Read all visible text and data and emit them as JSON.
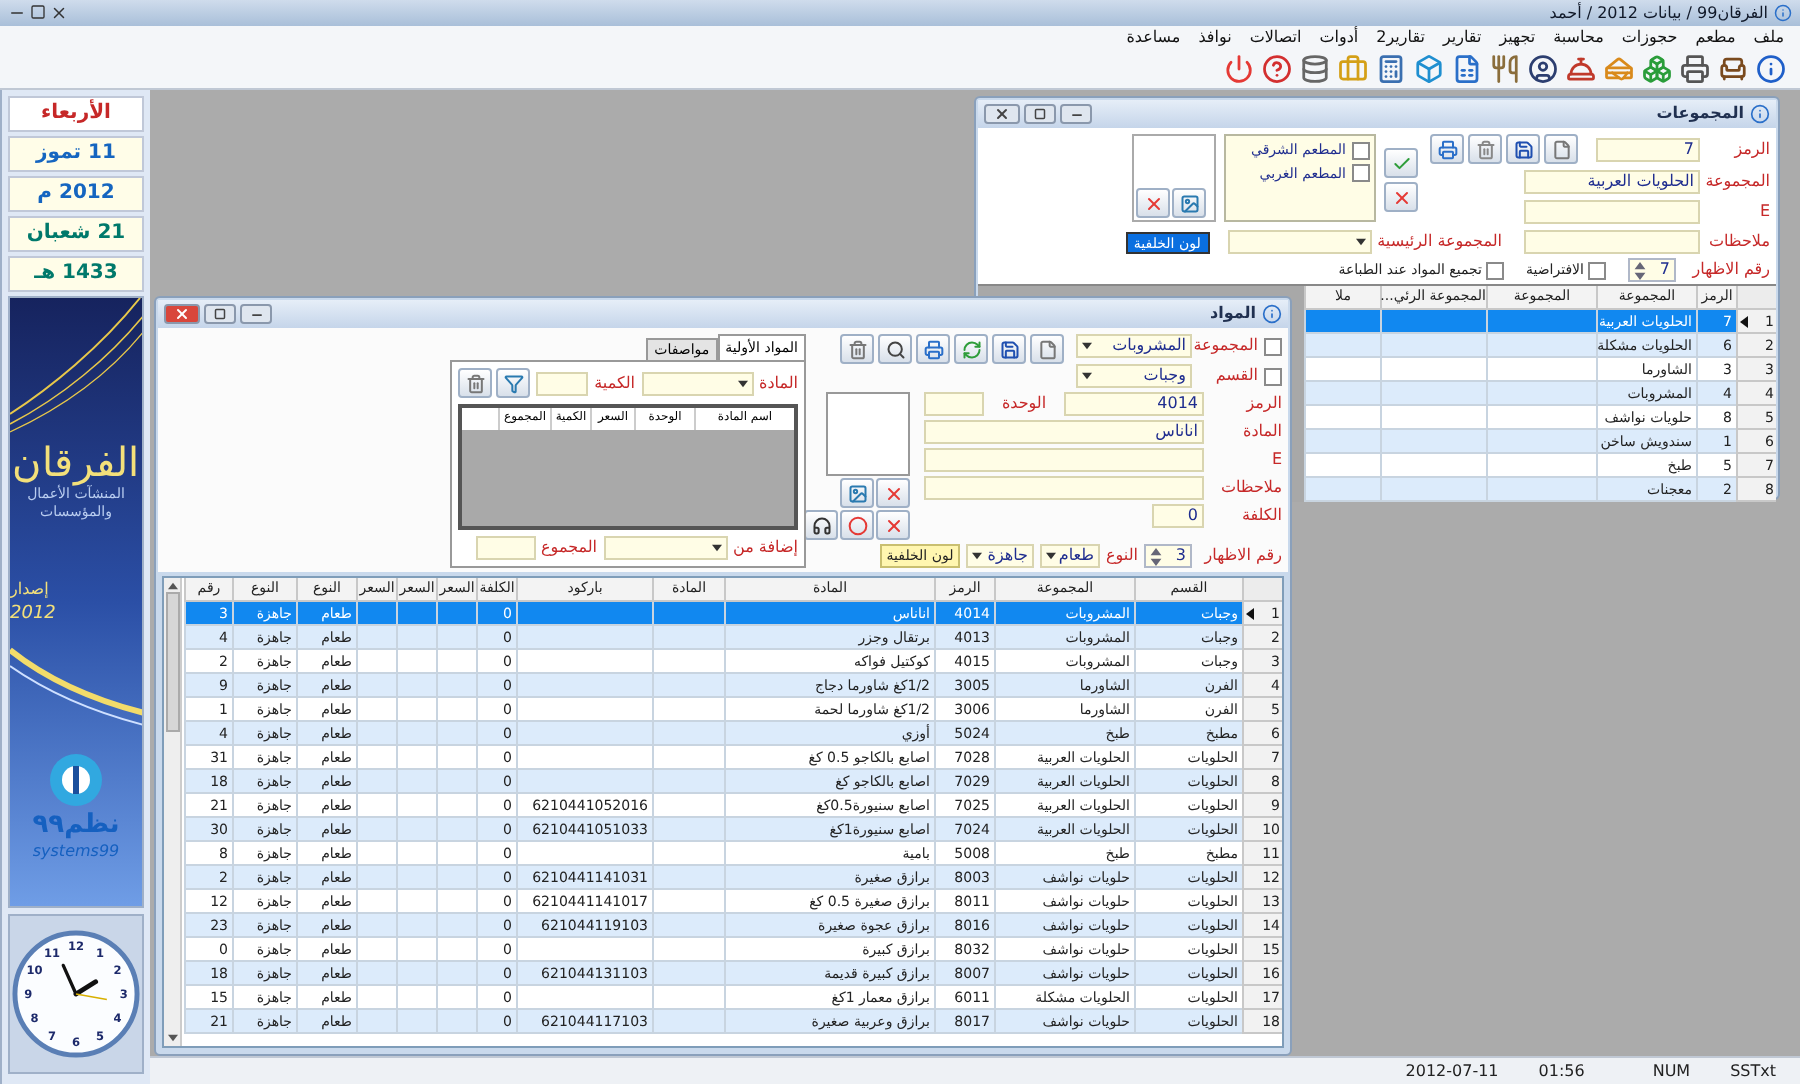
{
  "window": {
    "title": "الفرقان99 / بيانات 2012 / أحمد"
  },
  "menu": [
    "ملف",
    "مطعم",
    "حجوزات",
    "محاسبة",
    "تجهيز",
    "تقارير",
    "تقارير2",
    "أدوات",
    "اتصالات",
    "نوافذ",
    "مساعدة"
  ],
  "date_panel": {
    "weekday": "الأربعاء",
    "gregorian_date": "11 تموز",
    "gregorian_year": "2012 م",
    "hijri_date": "21 شعبان",
    "hijri_year": "1433 هـ"
  },
  "banner": {
    "product": "الفرقان",
    "tagline": "المنشآت الأعمال والمؤسسات",
    "edition_label": "إصدار",
    "edition_year": "2012",
    "brand": "نظم٩٩",
    "brand_latin": "systems99"
  },
  "clock": {
    "numerals": [
      "12",
      "1",
      "2",
      "3",
      "4",
      "5",
      "6",
      "7",
      "8",
      "9",
      "10",
      "11"
    ]
  },
  "groups_window": {
    "title": "المجموعات",
    "code": {
      "label": "الرمز",
      "value": "7"
    },
    "group": {
      "label": "المجموعة",
      "value": "الحلويات العربية"
    },
    "e": {
      "label": "E"
    },
    "notes": {
      "label": "ملاحظات"
    },
    "parent_group": {
      "label": "المجموعة الرئيسية"
    },
    "background_color_button": "لون الخلفية",
    "display_no": {
      "label": "رقم الاظهار",
      "value": "7"
    },
    "options": [
      {
        "label": "الافتراضية",
        "checked": false
      },
      {
        "label": "تجميع المواد عند الطباعة",
        "checked": false
      }
    ],
    "restaurants": [
      {
        "label": "المطعم الشرقي",
        "checked": false
      },
      {
        "label": "المطعم الغربي",
        "checked": false
      }
    ],
    "columns": [
      "الرمز",
      "المجموعة",
      "المجموعة",
      "المجموعة الرئي...",
      "ملا"
    ],
    "rows": [
      {
        "index": "1",
        "code": "7",
        "group": "الحلويات العربية",
        "selected": true
      },
      {
        "index": "2",
        "code": "6",
        "group": "الحلويات مشكلة",
        "selected": false
      },
      {
        "index": "3",
        "code": "3",
        "group": "الشاورما",
        "selected": false
      },
      {
        "index": "4",
        "code": "4",
        "group": "المشروبات",
        "selected": false
      },
      {
        "index": "5",
        "code": "8",
        "group": "حلويات نواشف",
        "selected": false
      },
      {
        "index": "6",
        "code": "1",
        "group": "سندويش ساخن",
        "selected": false
      },
      {
        "index": "7",
        "code": "5",
        "group": "طبخ",
        "selected": false
      },
      {
        "index": "8",
        "code": "2",
        "group": "معجنات",
        "selected": false
      }
    ]
  },
  "items_window": {
    "title": "المواد",
    "group_filter": {
      "label": "المجموعة",
      "value": "المشروبات",
      "checked": false
    },
    "section_filter": {
      "label": "القسم",
      "value": "وجبات",
      "checked": false
    },
    "code": {
      "label": "الرمز",
      "value": "4014"
    },
    "unit": {
      "label": "الوحدة"
    },
    "item": {
      "label": "المادة",
      "value": "اناناس"
    },
    "e": {
      "label": "E"
    },
    "notes": {
      "label": "ملاحظات"
    },
    "cost": {
      "label": "الكلفة",
      "value": "0"
    },
    "display_no": {
      "label": "رقم الاظهار",
      "value": "3"
    },
    "type": {
      "label": "النوع",
      "value": "طعام"
    },
    "status": {
      "value": "جاهزة"
    },
    "background_color_button": "لون الخلفية",
    "tabs": [
      {
        "label": "المواد الأولية",
        "selected": true
      },
      {
        "label": "مواصفات",
        "selected": false
      }
    ],
    "ingredients": {
      "item_label": "المادة",
      "quantity_label": "الكمية",
      "columns": [
        "اسم المادة",
        "الوحدة",
        "السعر",
        "الكمية",
        "المجموع"
      ],
      "add_from_label": "إضافة من",
      "total_label": "المجموع"
    },
    "grid": {
      "columns": [
        "القسم",
        "المجموعة",
        "الرمز",
        "المادة",
        "المادة",
        "باركود",
        "الكلفة",
        "السعر",
        "السعر",
        "السعر",
        "النوع",
        "النوع",
        "رقم"
      ],
      "rows": [
        {
          "index": "1",
          "section": "وجبات",
          "group": "المشروبات",
          "code": "4014",
          "item": "اناناس",
          "cost": "0",
          "type": "طعام",
          "status": "جاهزة",
          "number": "3",
          "selected": true
        },
        {
          "index": "2",
          "section": "وجبات",
          "group": "المشروبات",
          "code": "4013",
          "item": "برتقال وجزر",
          "cost": "0",
          "type": "طعام",
          "status": "جاهزة",
          "number": "4",
          "selected": false
        },
        {
          "index": "3",
          "section": "وجبات",
          "group": "المشروبات",
          "code": "4015",
          "item": "كوكتيل فواكه",
          "cost": "0",
          "type": "طعام",
          "status": "جاهزة",
          "number": "2",
          "selected": false
        },
        {
          "index": "4",
          "section": "الفرن",
          "group": "الشاورما",
          "code": "3005",
          "item": "1/2كغ شاورما دجاج",
          "cost": "0",
          "type": "طعام",
          "status": "جاهزة",
          "number": "9",
          "selected": false
        },
        {
          "index": "5",
          "section": "الفرن",
          "group": "الشاورما",
          "code": "3006",
          "item": "1/2كغ شاورما لحمة",
          "cost": "0",
          "type": "طعام",
          "status": "جاهزة",
          "number": "1",
          "selected": false
        },
        {
          "index": "6",
          "section": "مطبخ",
          "group": "طبخ",
          "code": "5024",
          "item": "أوزي",
          "cost": "0",
          "type": "طعام",
          "status": "جاهزة",
          "number": "4",
          "selected": false
        },
        {
          "index": "7",
          "section": "الحلويات",
          "group": "الحلويات العربية",
          "code": "7028",
          "item": "اصابع بالكاجو 0.5 كغ",
          "cost": "0",
          "type": "طعام",
          "status": "جاهزة",
          "number": "31",
          "selected": false
        },
        {
          "index": "8",
          "section": "الحلويات",
          "group": "الحلويات العربية",
          "code": "7029",
          "item": "اصابع بالكاجو كغ",
          "cost": "0",
          "type": "طعام",
          "status": "جاهزة",
          "number": "18",
          "selected": false
        },
        {
          "index": "9",
          "section": "الحلويات",
          "group": "الحلويات العربية",
          "code": "7025",
          "item": "اصابع سنيورة0.5كغ",
          "barcode": "6210441052016",
          "cost": "0",
          "type": "طعام",
          "status": "جاهزة",
          "number": "21",
          "selected": false
        },
        {
          "index": "10",
          "section": "الحلويات",
          "group": "الحلويات العربية",
          "code": "7024",
          "item": "اصابع سنيورة1كغ",
          "barcode": "6210441051033",
          "cost": "0",
          "type": "طعام",
          "status": "جاهزة",
          "number": "30",
          "selected": false
        },
        {
          "index": "11",
          "section": "مطبخ",
          "group": "طبخ",
          "code": "5008",
          "item": "بامية",
          "cost": "0",
          "type": "طعام",
          "status": "جاهزة",
          "number": "8",
          "selected": false
        },
        {
          "index": "12",
          "section": "الحلويات",
          "group": "حلويات نواشف",
          "code": "8003",
          "item": "برازق صغيرة",
          "barcode": "6210441141031",
          "cost": "0",
          "type": "طعام",
          "status": "جاهزة",
          "number": "2",
          "selected": false
        },
        {
          "index": "13",
          "section": "الحلويات",
          "group": "حلويات نواشف",
          "code": "8011",
          "item": "برازق صغيرة 0.5 كغ",
          "barcode": "6210441141017",
          "cost": "0",
          "type": "طعام",
          "status": "جاهزة",
          "number": "12",
          "selected": false
        },
        {
          "index": "14",
          "section": "الحلويات",
          "group": "حلويات نواشف",
          "code": "8016",
          "item": "برازق عجوة صغيرة",
          "barcode": "621044119103",
          "cost": "0",
          "type": "طعام",
          "status": "جاهزة",
          "number": "23",
          "selected": false
        },
        {
          "index": "15",
          "section": "الحلويات",
          "group": "حلويات نواشف",
          "code": "8032",
          "item": "برازق كبيرة",
          "cost": "0",
          "type": "طعام",
          "status": "جاهزة",
          "number": "0",
          "selected": false
        },
        {
          "index": "16",
          "section": "الحلويات",
          "group": "حلويات نواشف",
          "code": "8007",
          "item": "برازق كبيرة قديمة",
          "barcode": "621044131103",
          "cost": "0",
          "type": "طعام",
          "status": "جاهزة",
          "number": "18",
          "selected": false
        },
        {
          "index": "17",
          "section": "الحلويات",
          "group": "الحلويات مشكلة",
          "code": "6011",
          "item": "برازق معمار 1كغ",
          "cost": "0",
          "type": "طعام",
          "status": "جاهزة",
          "number": "15",
          "selected": false
        },
        {
          "index": "18",
          "section": "الحلويات",
          "group": "حلويات نواشف",
          "code": "8017",
          "item": "برازق وعربية صغيرة",
          "barcode": "621044117103",
          "cost": "0",
          "type": "طعام",
          "status": "جاهزة",
          "number": "21",
          "selected": false
        }
      ]
    }
  },
  "status_bar": [
    "SSTxt",
    "NUM",
    "01:56",
    "2012-07-11"
  ]
}
